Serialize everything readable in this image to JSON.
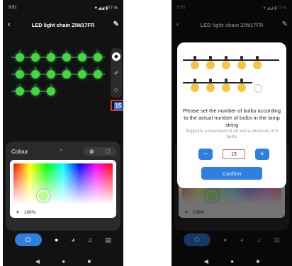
{
  "status": {
    "time": "9:51",
    "indicators": "▼◢◢ ▮77 %"
  },
  "header": {
    "title": "LED light chain ZIW17FR",
    "back_icon": "back-arrow-icon",
    "edit_icon": "pencil-icon"
  },
  "bulb_editor": {
    "bulb_count": "15",
    "rows": [
      6,
      6,
      3
    ],
    "bulb_color": "#43d742",
    "accent": "#2f6fd8"
  },
  "colour_panel": {
    "label": "Colour",
    "brightness": "100%"
  },
  "bottom_nav": {
    "items": [
      "power-icon",
      "bulb-icon",
      "palette-icon",
      "music-icon",
      "timer-icon"
    ]
  },
  "dialog": {
    "message": "Please set the number of bulbs according to the actual number of bulbs in the lamp string",
    "hint": "Supports a maximum of 48 and a minimum of 5 bulbs",
    "value": "15",
    "minus": "−",
    "plus": "+",
    "confirm": "Confirm",
    "bulb_color": "#f6c443"
  },
  "system_nav": {
    "back": "◀",
    "home": "●",
    "recents": "■"
  }
}
